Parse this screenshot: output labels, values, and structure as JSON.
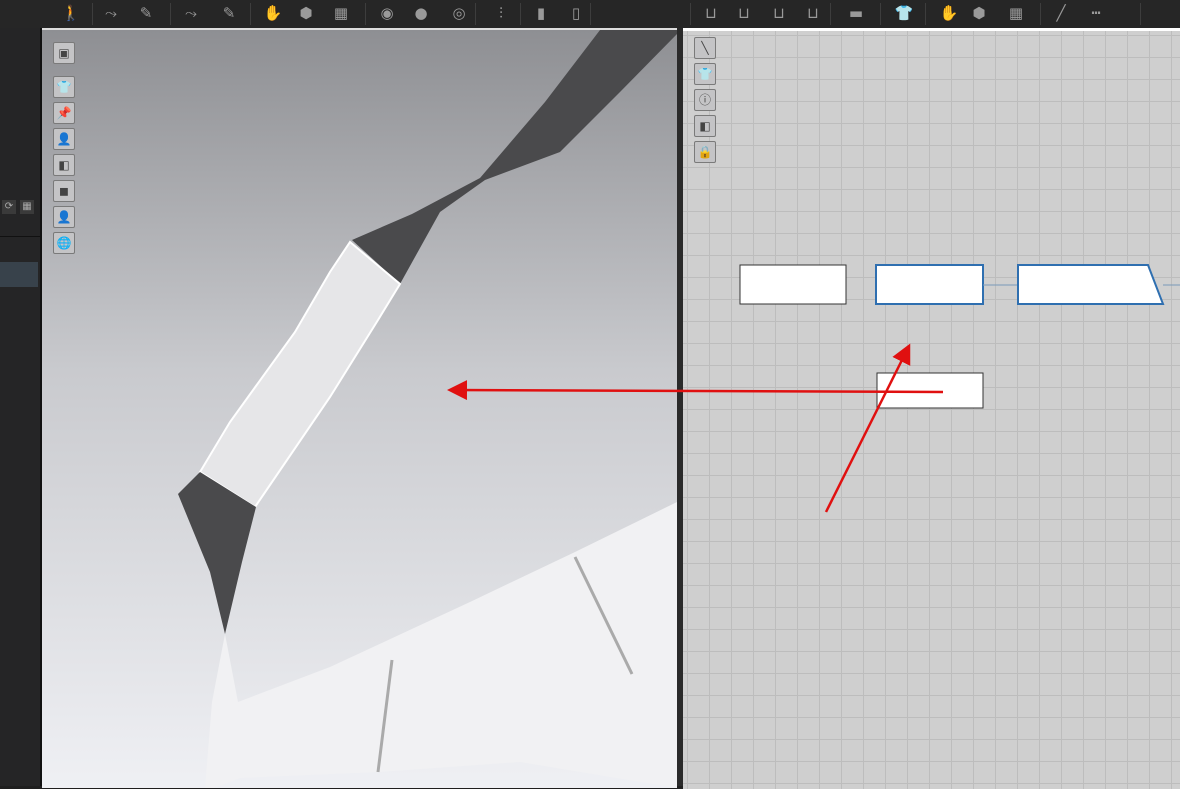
{
  "toolbar": {
    "icons": [
      "avatar-walk-icon",
      "edit-pattern-icon",
      "edit-curve-icon",
      "edit-pattern-2-icon",
      "edit-curve-2-icon",
      "fold-icon",
      "select-mesh-icon",
      "mesh-pattern-icon",
      "select-button-icon",
      "button-icon",
      "buttonhole-icon",
      "zipper-icon",
      "select-tape-icon",
      "tape-icon",
      "segment-sewing-icon",
      "free-sewing-icon",
      "multi-sewing-icon",
      "edit-sewing-icon",
      "iron-icon",
      "select-garment-icon",
      "fold-2-icon",
      "select-mesh-2-icon",
      "mesh-2-icon",
      "line-icon",
      "dashed-line-icon"
    ]
  },
  "left_panel": {
    "icons": [
      "refresh-icon",
      "grid-icon"
    ]
  },
  "view3d": {
    "icons": [
      "display-mode-icon",
      "show-garment-icon",
      "show-pins-icon",
      "show-avatar-icon",
      "texture-icon",
      "render-icon",
      "avatar-icon",
      "environment-icon"
    ]
  },
  "view2d": {
    "icons": [
      "show-sewing-icon",
      "show-garment-2d-icon",
      "info-icon",
      "texture-2d-icon",
      "lock-garment-icon"
    ]
  },
  "colors": {
    "arrow": "#e01010",
    "selected_outline": "#2f6fb0",
    "dark_fabric": "#4d4d4f",
    "light_fabric": "#e8e8ea"
  }
}
